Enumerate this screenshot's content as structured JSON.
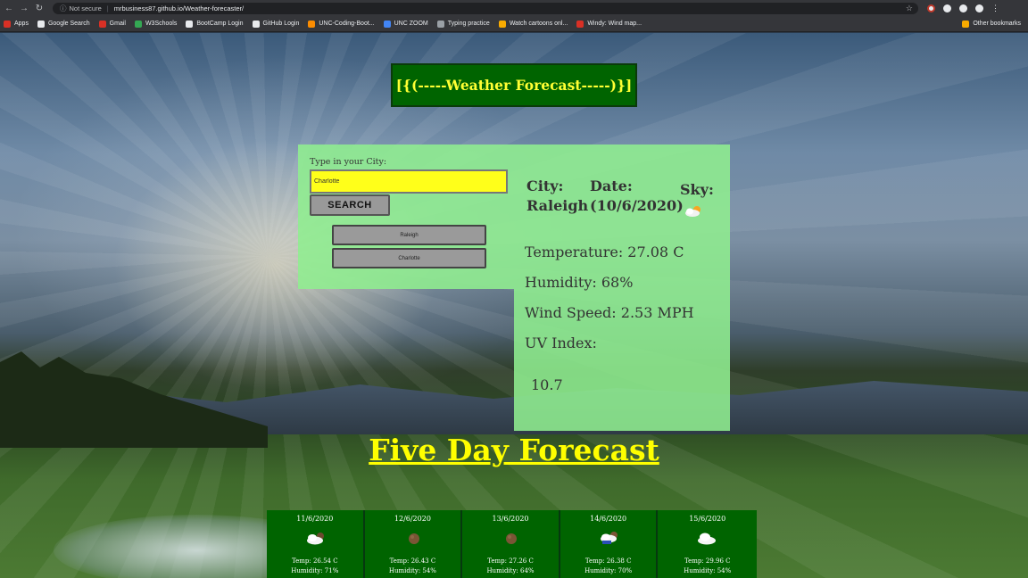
{
  "browser": {
    "security_label": "Not secure",
    "url": "mrbusiness87.github.io/Weather-forecaster/",
    "bookmarks": [
      {
        "label": "Apps",
        "color": "#d93025"
      },
      {
        "label": "Google Search",
        "color": "#e8eaed"
      },
      {
        "label": "Gmail",
        "color": "#d93025"
      },
      {
        "label": "W3Schools",
        "color": "#34a853"
      },
      {
        "label": "BootCamp Login",
        "color": "#e8eaed"
      },
      {
        "label": "GitHub Login",
        "color": "#e8eaed"
      },
      {
        "label": "UNC-Coding-Boot...",
        "color": "#fb8c00"
      },
      {
        "label": "UNC ZOOM",
        "color": "#4285f4"
      },
      {
        "label": "Typing practice",
        "color": "#9aa0a6"
      },
      {
        "label": "Watch cartoons onl...",
        "color": "#f9ab00"
      },
      {
        "label": "Windy: Wind map...",
        "color": "#d93025"
      }
    ],
    "other_bookmarks": "Other bookmarks"
  },
  "app": {
    "title": "[{(-----Weather Forecast-----)}]",
    "search": {
      "label": "Type in your City:",
      "input_value": "Charlotte",
      "button_label": "SEARCH"
    },
    "history": [
      "Raleigh",
      "Charlotte"
    ],
    "current": {
      "city_label": "City:",
      "city": "Raleigh",
      "date_label": "Date:",
      "date": "(10/6/2020)",
      "sky_label": "Sky:",
      "sky_icon": "partly-cloudy-icon",
      "temperature": "Temperature: 27.08 C",
      "humidity": "Humidity: 68%",
      "wind": "Wind Speed: 2.53 MPH",
      "uv_label": "UV Index:",
      "uv_value": "10.7"
    },
    "five_day_title": "Five Day Forecast",
    "forecast": [
      {
        "date": "11/6/2020",
        "icon": "partly-cloudy-icon",
        "temp": "Temp: 26.54 C",
        "humidity": "Humidity: 71%"
      },
      {
        "date": "12/6/2020",
        "icon": "moon-icon",
        "temp": "Temp: 26.43 C",
        "humidity": "Humidity: 54%"
      },
      {
        "date": "13/6/2020",
        "icon": "moon-icon",
        "temp": "Temp: 27.26 C",
        "humidity": "Humidity: 64%"
      },
      {
        "date": "14/6/2020",
        "icon": "rain-cloud-icon",
        "temp": "Temp: 26.38 C",
        "humidity": "Humidity: 70%"
      },
      {
        "date": "15/6/2020",
        "icon": "cloud-icon",
        "temp": "Temp: 29.96 C",
        "humidity": "Humidity: 54%"
      }
    ]
  },
  "colors": {
    "title_bg": "#006400",
    "title_text": "#ffff33",
    "panel_bg": "#90ee90",
    "input_bg": "#ffff1a",
    "forecast_bg": "#006400"
  }
}
